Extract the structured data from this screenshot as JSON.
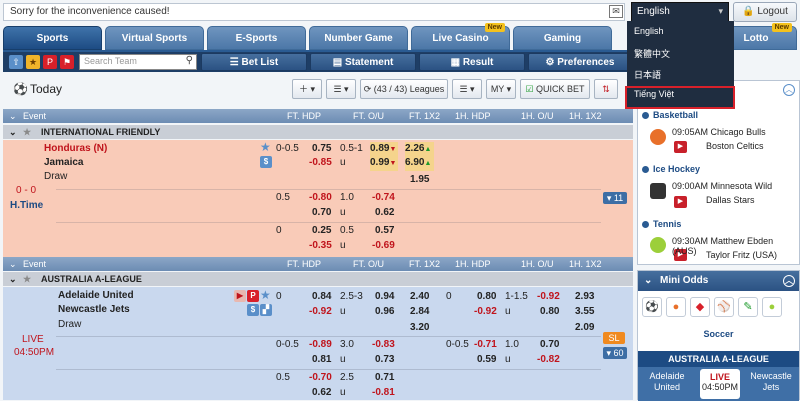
{
  "notice": "Sorry for the inconvenience caused!",
  "language": {
    "selected": "English",
    "options": [
      "English",
      "繁體中文",
      "日本語",
      "Tiếng Việt"
    ]
  },
  "logout_label": "Logout",
  "tabs": [
    {
      "label": "Sports",
      "active": true,
      "new": false
    },
    {
      "label": "Virtual Sports",
      "active": false,
      "new": false
    },
    {
      "label": "E-Sports",
      "active": false,
      "new": false
    },
    {
      "label": "Number Game",
      "active": false,
      "new": false
    },
    {
      "label": "Live Casino",
      "active": false,
      "new": true
    },
    {
      "label": "Gaming",
      "active": false,
      "new": false
    },
    {
      "label": "Lotto",
      "active": false,
      "new": true
    }
  ],
  "new_badge": "New",
  "toolbar": {
    "search_placeholder": "Search Team",
    "bet_list": "Bet List",
    "statement": "Statement",
    "result": "Result",
    "preferences": "Preferences"
  },
  "today": {
    "title": "Today",
    "leagues": "(43 / 43) Leagues",
    "odds_type": "MY",
    "quick_bet": "QUICK BET"
  },
  "columns": {
    "event": "Event",
    "ft_hdp": "FT. HDP",
    "ft_ou": "FT. O/U",
    "ft_1x2": "FT. 1X2",
    "h1_hdp": "1H. HDP",
    "h1_ou": "1H. O/U",
    "h1_1x2": "1H. 1X2"
  },
  "leagues": [
    {
      "name": "INTERNATIONAL FRIENDLY",
      "score": "0 - 0",
      "time": "H.Time",
      "home": "Honduras (N)",
      "away": "Jamaica",
      "draw": "Draw",
      "more": "11",
      "rows": [
        {
          "hdp": "0-0.5",
          "hdp_h": "0.75",
          "hdp_a": "-0.85",
          "ou": "0.5-1",
          "ou_u": "u",
          "ou_o": "0.89",
          "ou_un": "0.99",
          "x1": "2.26",
          "x2": "6.90",
          "x3": "1.95"
        },
        {
          "hdp": "0.5",
          "hdp_h": "-0.80",
          "hdp_a": "0.70",
          "ou": "1.0",
          "ou_u": "u",
          "ou_o": "-0.74",
          "ou_un": "0.62"
        },
        {
          "hdp": "0",
          "hdp_h": "0.25",
          "hdp_a": "-0.35",
          "ou": "0.5",
          "ou_u": "u",
          "ou_o": "0.57",
          "ou_un": "-0.69"
        }
      ]
    },
    {
      "name": "AUSTRALIA A-LEAGUE",
      "score": "LIVE",
      "time": "04:50PM",
      "home": "Adelaide United",
      "away": "Newcastle Jets",
      "draw": "Draw",
      "more": "60",
      "sl": "SL",
      "rows": [
        {
          "hdp": "0",
          "hdp_h": "0.84",
          "hdp_a": "-0.92",
          "ou": "2.5-3",
          "ou_u": "u",
          "ou_o": "0.94",
          "ou_un": "0.96",
          "x1": "2.40",
          "x2": "2.84",
          "x3": "3.20",
          "h_hdp": "0",
          "h_h": "0.80",
          "h_a": "-0.92",
          "h_ou": "1-1.5",
          "h_u": "u",
          "h_o": "-0.92",
          "h_un": "0.80",
          "h1": "2.93",
          "h2": "3.55",
          "h3": "2.09"
        },
        {
          "hdp": "0-0.5",
          "hdp_h": "-0.89",
          "hdp_a": "0.81",
          "ou": "3.0",
          "ou_u": "u",
          "ou_o": "-0.83",
          "ou_un": "0.73",
          "h_hdp": "0-0.5",
          "h_h": "-0.71",
          "h_a": "0.59",
          "h_ou": "1.0",
          "h_u": "u",
          "h_o": "0.70",
          "h_un": "-0.82"
        },
        {
          "hdp": "0.5",
          "hdp_h": "-0.70",
          "hdp_a": "0.62",
          "ou": "2.5",
          "ou_u": "u",
          "ou_o": "0.71",
          "ou_un": "-0.81"
        }
      ]
    }
  ],
  "live_panel": {
    "categories": [
      {
        "name": "Basketball",
        "time": "09:05AM",
        "home": "Chicago Bulls",
        "away": "Boston Celtics"
      },
      {
        "name": "Ice Hockey",
        "time": "09:00AM",
        "home": "Minnesota Wild",
        "away": "Dallas Stars"
      },
      {
        "name": "Tennis",
        "time": "09:30AM",
        "home": "Matthew Ebden (AUS)",
        "away": "Taylor Fritz (USA)"
      }
    ]
  },
  "mini_odds": {
    "title": "Mini Odds",
    "sport": "Soccer",
    "league": "AUSTRALIA A-LEAGUE",
    "home": "Adelaide United",
    "live": "LIVE",
    "time": "04:50PM",
    "away": "Newcastle Jets"
  },
  "colors": {
    "accent": "#2a5b92",
    "negative": "#c0141c",
    "row_live": "#f9cbb8",
    "row_upcoming": "#c9d8ee"
  }
}
